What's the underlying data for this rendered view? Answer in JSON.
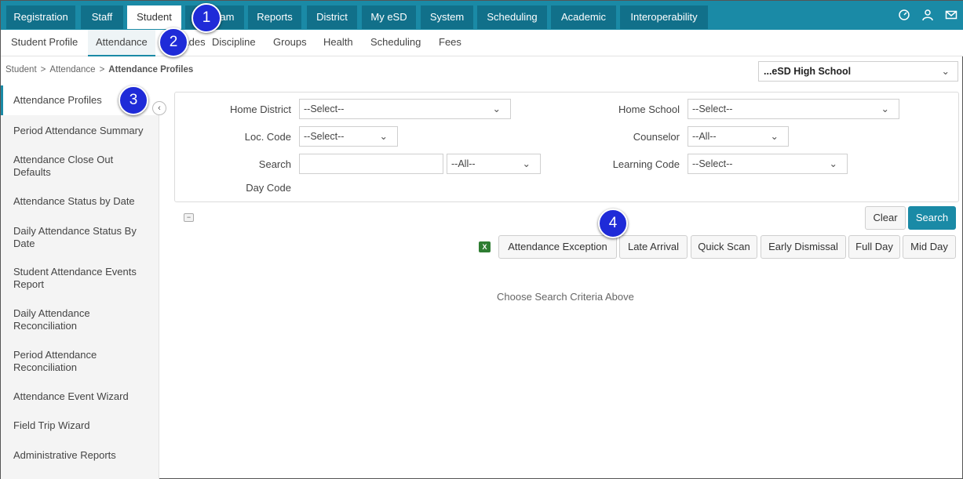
{
  "topnav": {
    "tabs": [
      "Registration",
      "Staff",
      "Student",
      "Program",
      "Reports",
      "District",
      "My eSD",
      "System",
      "Scheduling",
      "Academic",
      "Interoperability"
    ],
    "active": "Student",
    "icons": [
      "dashboard-icon",
      "user-icon",
      "mail-icon"
    ]
  },
  "subnav": {
    "tabs": [
      "Student Profile",
      "Attendance",
      "Grades",
      "Discipline",
      "Groups",
      "Health",
      "Scheduling",
      "Fees"
    ],
    "active": "Attendance"
  },
  "breadcrumb": {
    "items": [
      "Student",
      "Attendance",
      "Attendance Profiles"
    ],
    "separator": ">"
  },
  "school_selector": {
    "value": "...eSD High School"
  },
  "sidebar": {
    "items": [
      "Attendance Profiles",
      "Period Attendance Summary",
      "Attendance Close Out Defaults",
      "Attendance Status by Date",
      "Daily Attendance Status By Date",
      "Student Attendance Events Report",
      "Daily Attendance Reconciliation",
      "Period Attendance Reconciliation",
      "Attendance Event Wizard",
      "Field Trip Wizard",
      "Administrative Reports"
    ],
    "active": "Attendance Profiles",
    "collapse_glyph": "‹"
  },
  "filters": {
    "home_district": {
      "label": "Home District",
      "value": "--Select--"
    },
    "home_school": {
      "label": "Home School",
      "value": "--Select--"
    },
    "loc_code": {
      "label": "Loc. Code",
      "value": "--Select--"
    },
    "counselor": {
      "label": "Counselor",
      "value": "--All--"
    },
    "search_label": "Search",
    "day_code_label": "Day Code",
    "day_code_select": "--All--",
    "learning_code": {
      "label": "Learning Code",
      "value": "--Select--"
    }
  },
  "actions": {
    "clear": "Clear",
    "search": "Search",
    "minus": "−",
    "report_buttons": [
      "Attendance Exception",
      "Late Arrival",
      "Quick Scan",
      "Early Dismissal",
      "Full Day",
      "Mid Day"
    ]
  },
  "results": {
    "empty_message": "Choose Search Criteria Above"
  },
  "callouts": [
    "1",
    "2",
    "3",
    "4"
  ],
  "chevron": "⌄",
  "colors": {
    "accent": "#1a8aa6",
    "tab_dark": "#11708a",
    "callout": "#1f2bd8"
  }
}
